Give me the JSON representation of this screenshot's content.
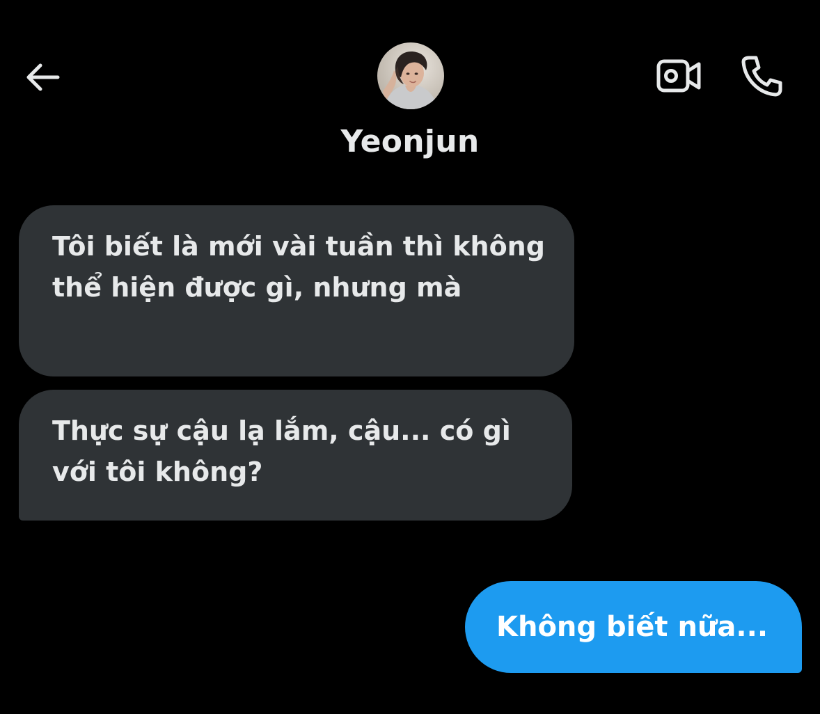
{
  "header": {
    "back_icon": "arrow-left-icon",
    "contact_name": "Yeonjun",
    "avatar_alt": "Yeonjun",
    "video_icon": "video-camera-icon",
    "call_icon": "phone-icon"
  },
  "messages": [
    {
      "sender": "contact",
      "text": "Tôi biết là mới vài tuần thì không thể hiện được gì, nhưng mà"
    },
    {
      "sender": "contact",
      "text": "Thực sự cậu lạ lắm, cậu... có gì với tôi không?"
    },
    {
      "sender": "me",
      "text": "Không biết nữa..."
    }
  ],
  "colors": {
    "background": "#000000",
    "received_bubble": "#2f3336",
    "sent_bubble": "#1d9bf0",
    "text": "#e7e9ea"
  }
}
